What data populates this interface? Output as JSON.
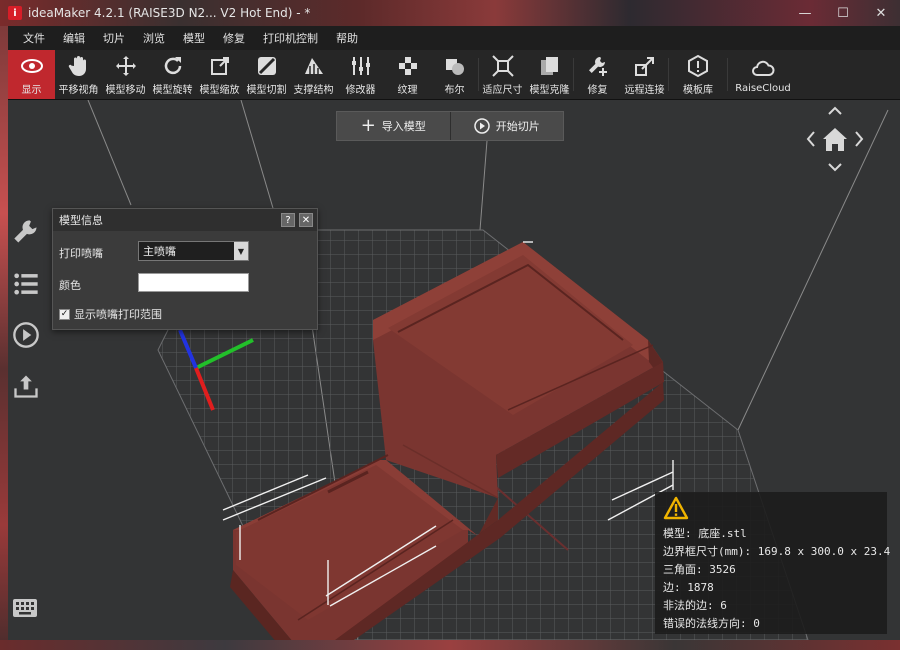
{
  "titlebar": {
    "title": "ideaMaker 4.2.1 (RAISE3D N2... V2 Hot End) - *",
    "minimize": "—",
    "maximize": "☐",
    "close": "✕"
  },
  "menu": [
    "文件",
    "编辑",
    "切片",
    "浏览",
    "模型",
    "修复",
    "打印机控制",
    "帮助"
  ],
  "toolbar": [
    {
      "label": "显示",
      "icon": "eye-icon"
    },
    {
      "label": "平移视角",
      "icon": "hand-icon"
    },
    {
      "label": "模型移动",
      "icon": "move-icon"
    },
    {
      "label": "模型旋转",
      "icon": "rotate-icon"
    },
    {
      "label": "模型缩放",
      "icon": "scale-icon"
    },
    {
      "label": "模型切割",
      "icon": "cut-icon"
    },
    {
      "label": "支撑结构",
      "icon": "support-icon"
    },
    {
      "label": "修改器",
      "icon": "modifier-icon"
    },
    {
      "label": "纹理",
      "icon": "texture-icon"
    },
    {
      "label": "布尔",
      "icon": "boolean-icon"
    },
    {
      "label": "适应尺寸",
      "icon": "fit-icon"
    },
    {
      "label": "模型克隆",
      "icon": "clone-icon"
    },
    {
      "label": "修复",
      "icon": "repair-icon"
    },
    {
      "label": "远程连接",
      "icon": "remote-icon"
    },
    {
      "label": "模板库",
      "icon": "template-icon"
    },
    {
      "label": "RaiseCloud",
      "icon": "cloud-icon"
    }
  ],
  "actions": {
    "import_label": "导入模型",
    "slice_label": "开始切片"
  },
  "panel": {
    "title": "模型信息",
    "help": "?",
    "close": "✕",
    "nozzle_label": "打印喷嘴",
    "nozzle_value": "主喷嘴",
    "color_label": "颜色",
    "show_range_label": "显示喷嘴打印范围",
    "show_range_checked": true
  },
  "info": {
    "model": "模型: 底座.stl",
    "bbox": "边界框尺寸(mm): 169.8 x 300.0 x 23.4",
    "triangles": "三角面: 3526",
    "edges": "边: 1878",
    "bad_edges": "非法的边: 6",
    "bad_normals": "错误的法线方向: 0"
  },
  "colors": {
    "accent": "#c0282e",
    "model": "#7a3530",
    "viewport": "#333435"
  }
}
